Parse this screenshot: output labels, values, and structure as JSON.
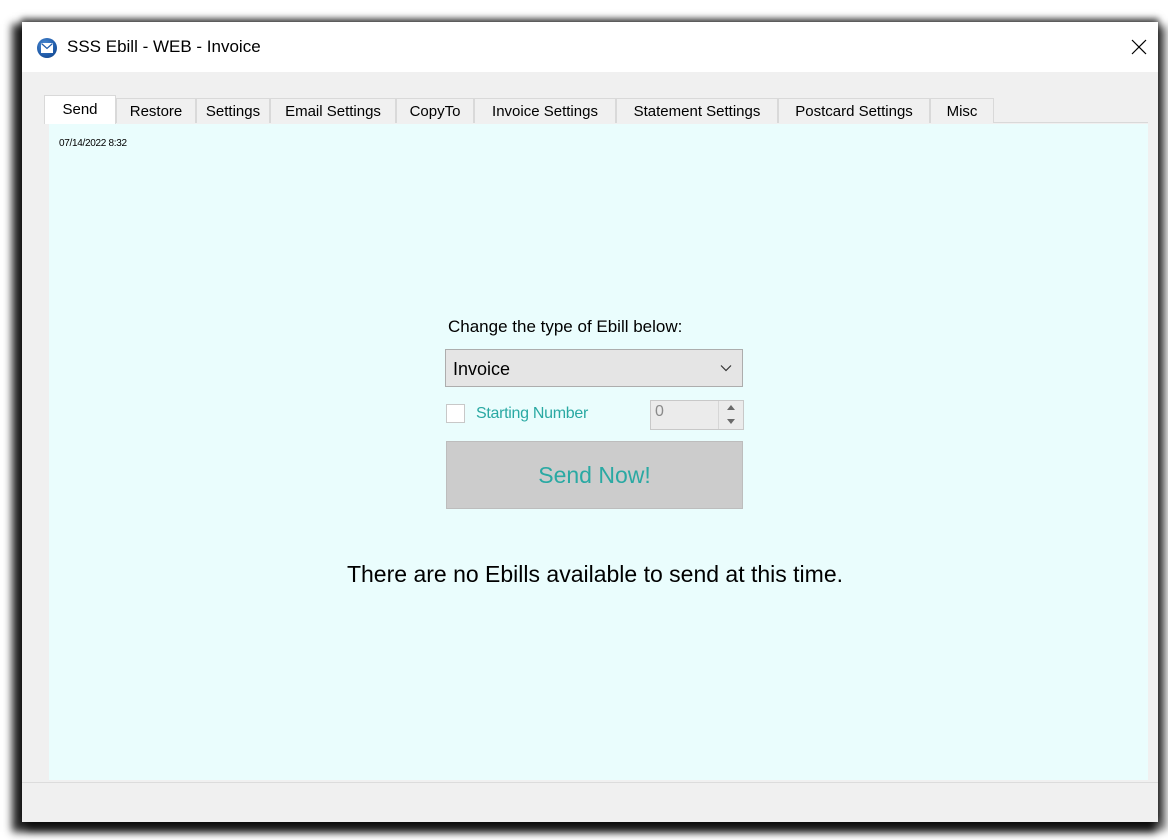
{
  "window": {
    "title": "SSS Ebill - WEB - Invoice",
    "icon": "app-envelope-icon",
    "close_icon": "close-icon"
  },
  "tabs": [
    {
      "label": "Send",
      "active": true
    },
    {
      "label": "Restore",
      "active": false
    },
    {
      "label": "Settings",
      "active": false
    },
    {
      "label": "Email Settings",
      "active": false
    },
    {
      "label": "CopyTo",
      "active": false
    },
    {
      "label": "Invoice Settings",
      "active": false
    },
    {
      "label": "Statement Settings",
      "active": false
    },
    {
      "label": "Postcard Settings",
      "active": false
    },
    {
      "label": "Misc",
      "active": false
    }
  ],
  "send_panel": {
    "timestamp": "07/14/2022 8:32",
    "prompt": "Change the type of Ebill below:",
    "ebill_type": {
      "selected": "Invoice"
    },
    "starting_number": {
      "label": "Starting Number",
      "checked": false,
      "value": "0"
    },
    "send_button_label": "Send Now!",
    "status_message": "There are no Ebills available to send at this time."
  },
  "colors": {
    "panel_background": "#eafdfd",
    "accent_teal": "#2aa9a3",
    "button_gray": "#cccccc"
  }
}
